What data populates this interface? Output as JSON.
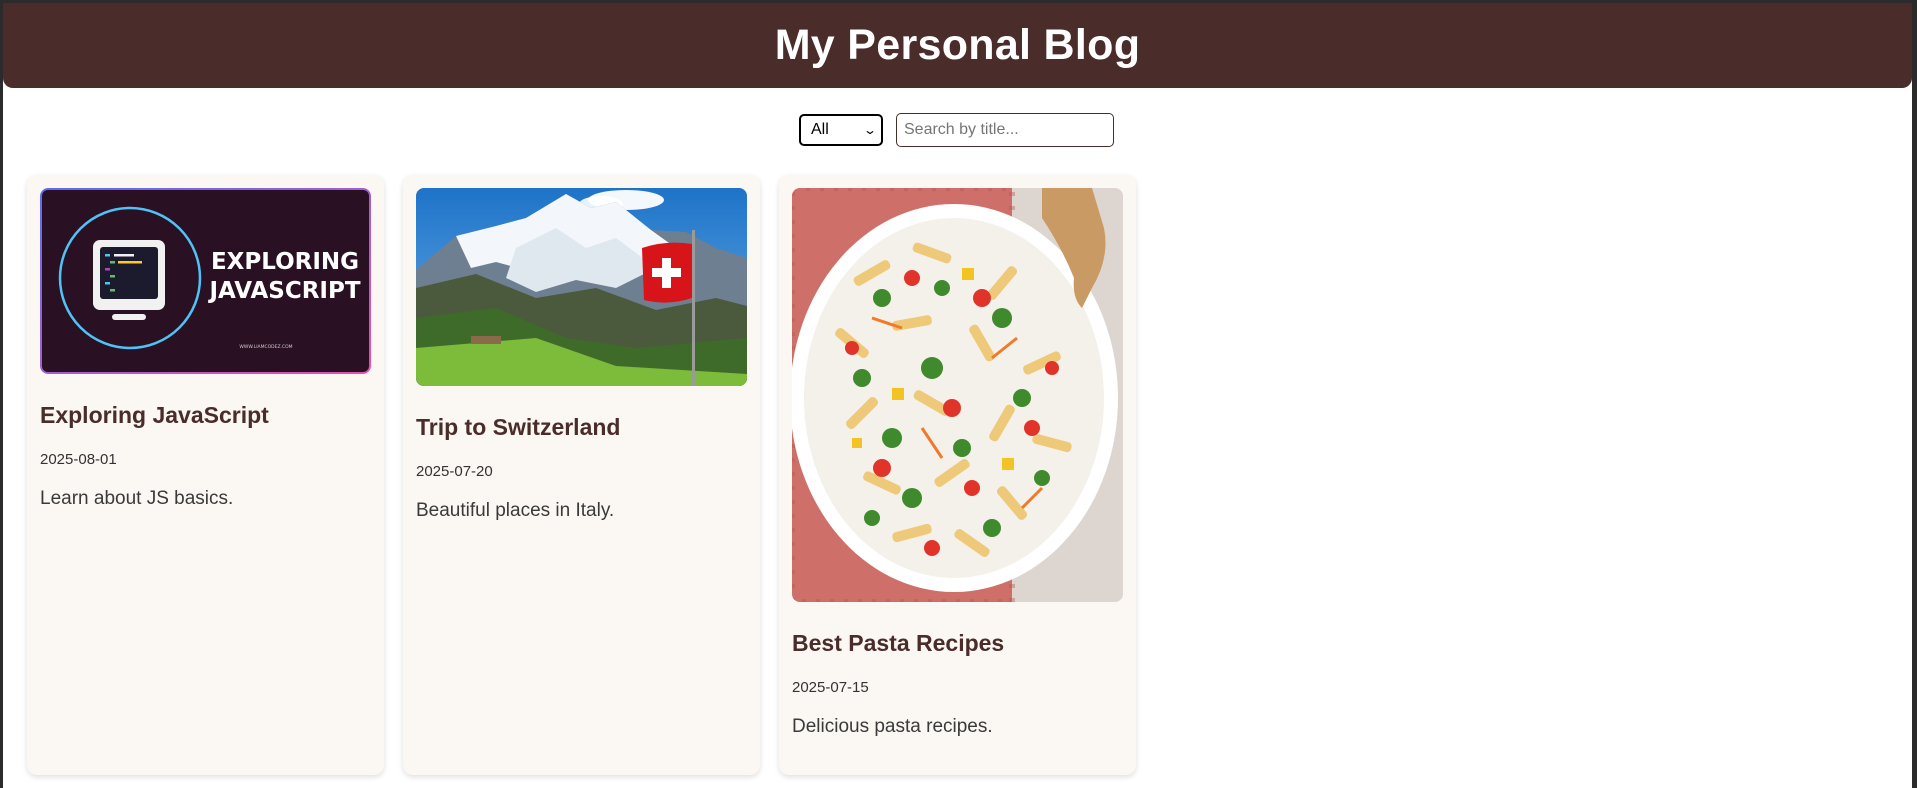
{
  "header": {
    "title": "My Personal Blog"
  },
  "filter": {
    "category_selected": "All",
    "search_placeholder": "Search by title..."
  },
  "posts": [
    {
      "title": "Exploring JavaScript",
      "date": "2025-08-01",
      "description": "Learn about JS basics.",
      "image": {
        "kind": "javascript-banner",
        "banner_text_line1": "EXPLORING",
        "banner_text_line2": "JAVASCRIPT",
        "banner_footer": "WWW.LIAMCODEZ.COM"
      }
    },
    {
      "title": "Trip to Switzerland",
      "date": "2025-07-20",
      "description": "Beautiful places in Italy.",
      "image": {
        "kind": "swiss-mountains-flag"
      }
    },
    {
      "title": "Best Pasta Recipes",
      "date": "2025-07-15",
      "description": "Delicious pasta recipes.",
      "image": {
        "kind": "pasta-salad-plate"
      }
    }
  ],
  "colors": {
    "header_bg": "#4a2c2a",
    "card_bg": "#fbf7f3",
    "accent_text": "#4a2c2a"
  }
}
